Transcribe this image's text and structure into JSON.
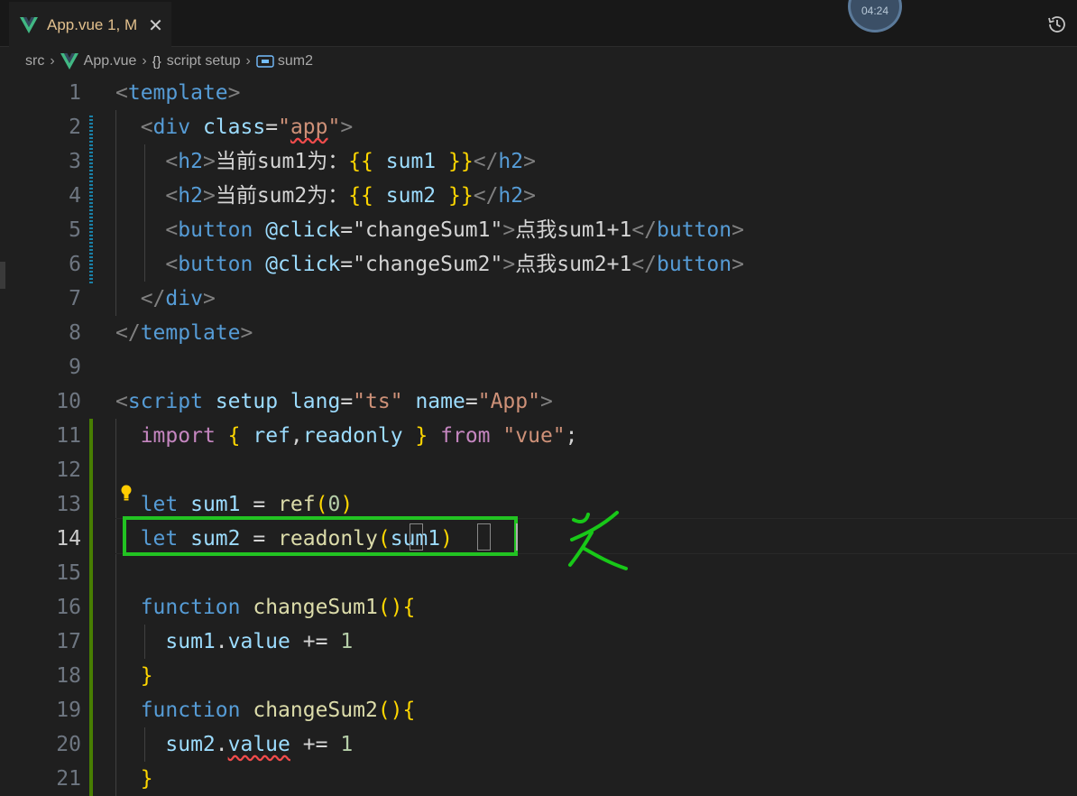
{
  "tab": {
    "name": "App.vue 1, M",
    "close": "✕"
  },
  "timer": "04:24",
  "breadcrumb": {
    "src": "src",
    "file": "App.vue",
    "braces": "{}",
    "scope": "script setup",
    "symbol": "sum2"
  },
  "lines": {
    "n1": "1",
    "n2": "2",
    "n3": "3",
    "n4": "4",
    "n5": "5",
    "n6": "6",
    "n7": "7",
    "n8": "8",
    "n9": "9",
    "n10": "10",
    "n11": "11",
    "n12": "12",
    "n13": "13",
    "n14": "14",
    "n15": "15",
    "n16": "16",
    "n17": "17",
    "n18": "18",
    "n19": "19",
    "n20": "20",
    "n21": "21"
  },
  "code": {
    "template": "template",
    "div": "div",
    "class_attr": "class",
    "app": "app",
    "h2": "h2",
    "h2_text1": "当前sum1为：",
    "h2_text2": "当前sum2为：",
    "sum1": "sum1",
    "sum2": "sum2",
    "button": "button",
    "click_attr": "@click",
    "changeSum1": "changeSum1",
    "changeSum2": "changeSum2",
    "btn_text1": "点我sum1+1",
    "btn_text2": "点我sum2+1",
    "script": "script",
    "setup": "setup",
    "lang": "lang",
    "ts": "ts",
    "name_attr": "name",
    "App": "App",
    "import": "import",
    "ref": "ref",
    "readonly": "readonly",
    "from": "from",
    "vue": "vue",
    "let": "let",
    "zero": "0",
    "function": "function",
    "value": "value",
    "one": "1"
  },
  "colors": {
    "highlight_box": "#22c322",
    "tab_modified": "#e2c08d",
    "git_added": "#487e02",
    "git_modified": "#1b81a8"
  },
  "icons": {
    "vue": "vue-logo-icon",
    "history": "history-icon",
    "lightbulb": "lightbulb-icon",
    "variable": "variable-icon"
  }
}
